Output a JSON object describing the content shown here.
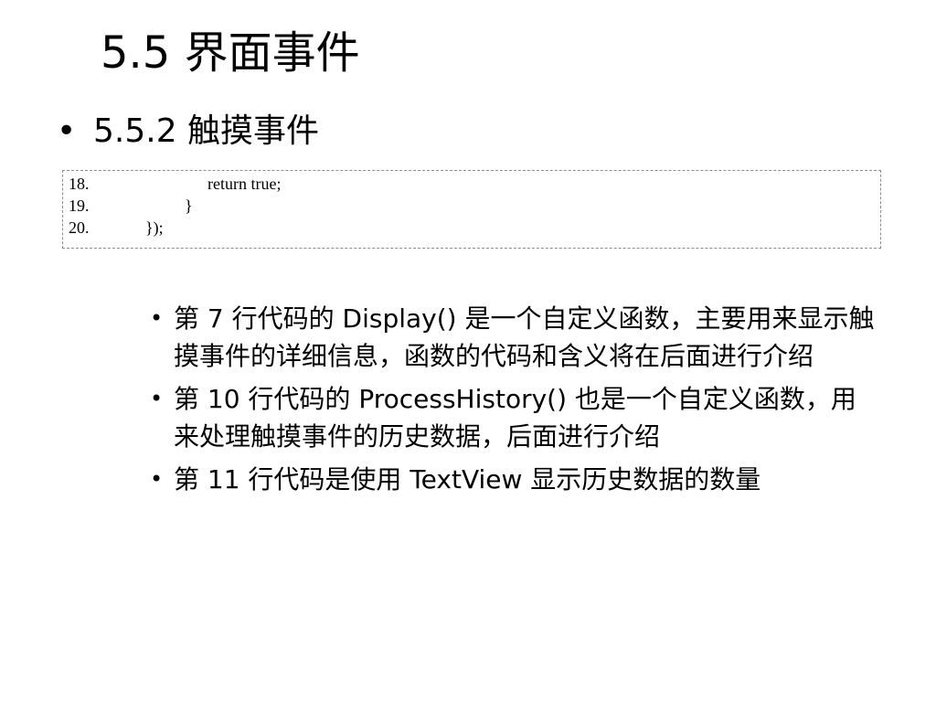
{
  "title": "5.5  界面事件",
  "subheading": {
    "bullet": "•",
    "text": "5.5.2  触摸事件"
  },
  "code_lines": [
    {
      "num": "18.",
      "code": "return true;"
    },
    {
      "num": "19.",
      "code": "}"
    },
    {
      "num": "20.",
      "code": "});"
    }
  ],
  "bullets": [
    "第 7 行代码的 Display() 是一个自定义函数，主要用来显示触摸事件的详细信息，函数的代码和含义将在后面进行介绍",
    "第 10 行代码的 ProcessHistory() 也是一个自定义函数，用来处理触摸事件的历史数据，后面进行介绍",
    "第 11 行代码是使用 TextView 显示历史数据的数量"
  ]
}
